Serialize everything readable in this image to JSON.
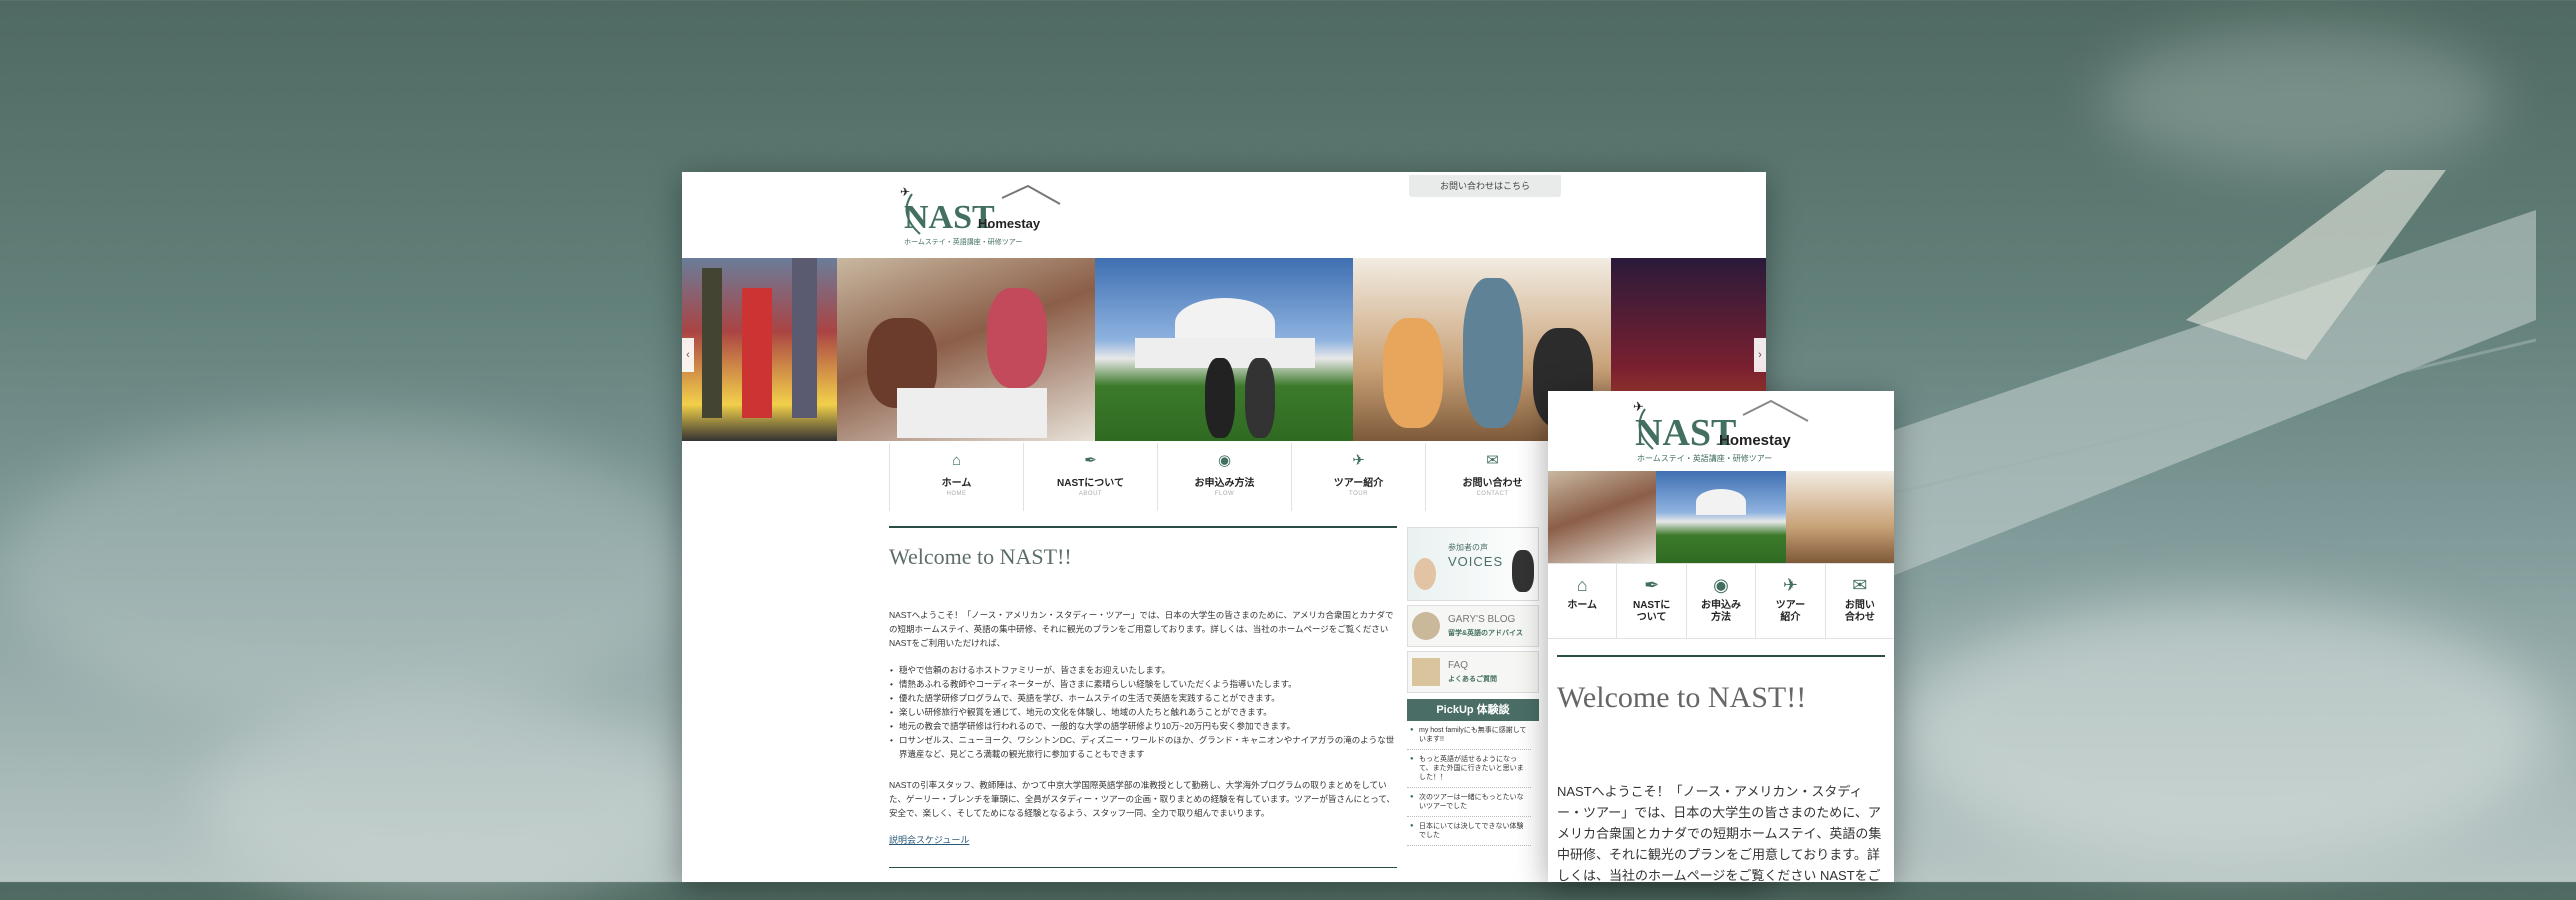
{
  "colors": {
    "brand_green": "#426f60",
    "dark_rule": "#2c4d47",
    "pickup_bg": "#4a6e66"
  },
  "desktop": {
    "logo": {
      "brand": "NAST",
      "sub": "Homestay",
      "tagline": "ホームステイ・英語講座・研修ツアー"
    },
    "contact_tab": "お問い合わせはこちら",
    "slider": {
      "prev_icon": "chevron-left-icon",
      "next_icon": "chevron-right-icon"
    },
    "nav": [
      {
        "label": "ホーム",
        "sub": "HOME",
        "icon": "home-icon"
      },
      {
        "label": "NASTについて",
        "sub": "ABOUT",
        "icon": "feather-icon"
      },
      {
        "label": "お申込み方法",
        "sub": "FLOW",
        "icon": "globe-icon"
      },
      {
        "label": "ツアー紹介",
        "sub": "TOUR",
        "icon": "plane-icon"
      },
      {
        "label": "お問い合わせ",
        "sub": "CONTACT",
        "icon": "mail-icon"
      }
    ],
    "welcome": "Welcome to NAST!!",
    "intro": "NASTへようこそ！「ノース・アメリカン・スタディー・ツアー」では、日本の大学生の皆さまのために、アメリカ合衆国とカナダでの短期ホームステイ、英語の集中研修、それに観光のプランをご用意しております。詳しくは、当社のホームページをご覧くださいNASTをご利用いただければ、",
    "bullets": [
      "穏やで信頼のおけるホストファミリーが、皆さまをお迎えいたします。",
      "情熱あふれる教師やコーディネーターが、皆さまに素晴らしい経験をしていただくよう指導いたします。",
      "優れた語学研修プログラムで、英語を学び、ホームステイの生活で英語を実践することができます。",
      "楽しい研修旅行や観賞を通じて、地元の文化を体験し、地域の人たちと触れあうことができます。",
      "地元の教会で語学研修は行われるので、一般的な大学の語学研修より10万~20万円も安く参加できます。",
      "ロサンゼルス、ニューヨーク、ワシントンDC、ディズニー・ワールドのほか、グランド・キャニオンやナイアガラの滝のような世界遺産など、見どころ満載の観光旅行に参加することもできます"
    ],
    "staff": "NASTの引率スタッフ、教師陣は、かつて中京大学国際英語学部の准教授として勤務し、大学海外プログラムの取りまとめをしていた、ゲーリー・ブレンチを筆頭に、全員がスタディー・ツアーの企画・取りまとめの経験を有しています。ツアーが皆さんにとって、安全で、楽しく、そしてためになる経験となるよう、スタッフ一同、全力で取り組んでまいります。",
    "schedule_link": "説明会スケジュール",
    "sidebar": {
      "voices": {
        "small": "参加者の声",
        "big": "VOICES"
      },
      "blog": {
        "title": "GARY'S BLOG",
        "sub": "留学&英語のアドバイス"
      },
      "faq": {
        "title": "FAQ",
        "sub": "よくあるご質問"
      },
      "pickup_title": "PickUp 体験談",
      "pickup_items": [
        "my host familyにも無事に感謝しています!!",
        "もっと英語が話せるようになって、また外国に行きたいと思いました！！",
        "次のツアーは一緒にもっとたいないツアーでした",
        "日本にいては決してできない体験でした"
      ]
    }
  },
  "mobile": {
    "logo": {
      "brand": "NAST",
      "sub": "Homestay",
      "tagline": "ホームステイ・英語講座・研修ツアー"
    },
    "nav": [
      {
        "label": "ホーム",
        "icon": "home-icon"
      },
      {
        "label": "NASTに\nついて",
        "icon": "feather-icon"
      },
      {
        "label": "お申込み\n方法",
        "icon": "globe-icon"
      },
      {
        "label": "ツアー\n紹介",
        "icon": "plane-icon"
      },
      {
        "label": "お問い\n合わせ",
        "icon": "mail-icon"
      }
    ],
    "welcome": "Welcome to NAST!!",
    "intro": "NASTへようこそ！「ノース・アメリカン・スタディー・ツアー」では、日本の大学生の皆さまのために、アメリカ合衆国とカナダでの短期ホームステイ、英語の集中研修、それに観光のプランをご用意しております。詳しくは、当社のホームページをご覧ください NASTをご利"
  }
}
